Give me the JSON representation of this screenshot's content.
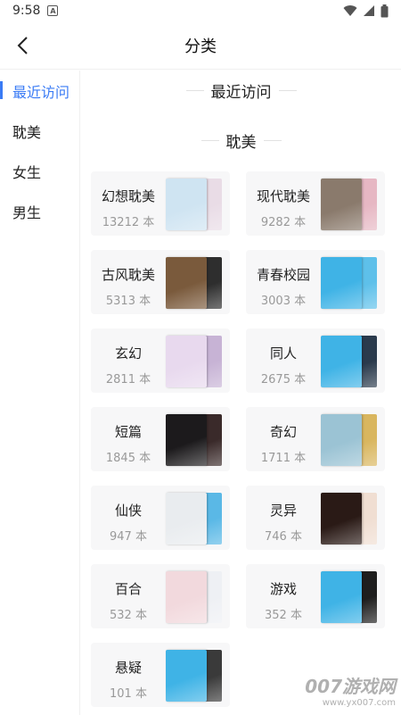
{
  "status": {
    "time": "9:58",
    "notif_icon": "A"
  },
  "header": {
    "title": "分类"
  },
  "sidebar": {
    "items": [
      {
        "label": "最近访问",
        "active": true
      },
      {
        "label": "耽美",
        "active": false
      },
      {
        "label": "女生",
        "active": false
      },
      {
        "label": "男生",
        "active": false
      }
    ]
  },
  "main": {
    "section_recent": "最近访问",
    "section_danmei": "耽美",
    "categories": [
      {
        "name": "幻想耽美",
        "count": "13212 本",
        "cover_front": "#cfe4f2",
        "cover_back": "#e9dce6"
      },
      {
        "name": "现代耽美",
        "count": "9282 本",
        "cover_front": "#8a7a6c",
        "cover_back": "#e6b7c3"
      },
      {
        "name": "古风耽美",
        "count": "5313 本",
        "cover_front": "#7a5a3c",
        "cover_back": "#2e2e2e"
      },
      {
        "name": "青春校园",
        "count": "3003 本",
        "cover_front": "#3fb3e6",
        "cover_back": "#5ec0ea"
      },
      {
        "name": "玄幻",
        "count": "2811 本",
        "cover_front": "#e8d9ee",
        "cover_back": "#c7b3d5"
      },
      {
        "name": "同人",
        "count": "2675 本",
        "cover_front": "#3fb3e6",
        "cover_back": "#2a3a4c"
      },
      {
        "name": "短篇",
        "count": "1845 本",
        "cover_front": "#1c1a1c",
        "cover_back": "#3a2a2a"
      },
      {
        "name": "奇幻",
        "count": "1711 本",
        "cover_front": "#9bc3d4",
        "cover_back": "#d9b65f"
      },
      {
        "name": "仙侠",
        "count": "947 本",
        "cover_front": "#e9ecef",
        "cover_back": "#5ab8e6"
      },
      {
        "name": "灵异",
        "count": "746 本",
        "cover_front": "#2a1a16",
        "cover_back": "#f0ded2"
      },
      {
        "name": "百合",
        "count": "532 本",
        "cover_front": "#f2d9dd",
        "cover_back": "#eef0f4"
      },
      {
        "name": "游戏",
        "count": "352 本",
        "cover_front": "#3fb3e6",
        "cover_back": "#1e1e1e"
      },
      {
        "name": "悬疑",
        "count": "101 本",
        "cover_front": "#3fb3e6",
        "cover_back": "#3a3a3a"
      }
    ]
  },
  "watermark": {
    "main": "007游戏网",
    "url": "www.yx007.com"
  }
}
